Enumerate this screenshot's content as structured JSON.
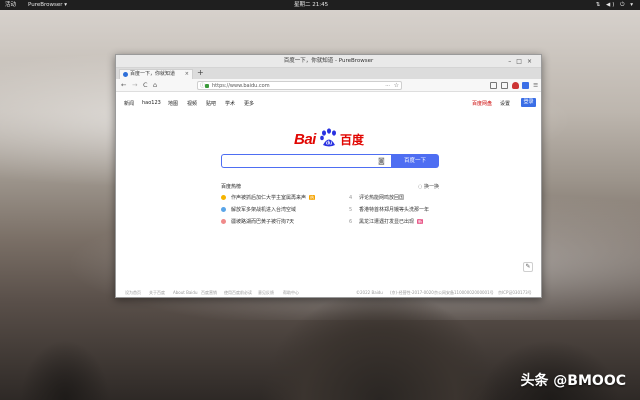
{
  "system_bar": {
    "activities": "活动",
    "app_menu": "PureBrowser ▾",
    "clock": "星期二 21:45",
    "tray": "⇅ ◀) ⏻ ▾"
  },
  "window": {
    "title": "百度一下，你就知道 - PureBrowser",
    "controls": [
      "–",
      "□",
      "×"
    ]
  },
  "tabs": [
    {
      "label": "百度一下，你就知道",
      "close": "×"
    }
  ],
  "new_tab": "+",
  "nav": {
    "back": "←",
    "forward": "→",
    "reload": "C",
    "home": "⌂",
    "url": "https://www.baidu.com",
    "url_info": "ⓘ",
    "page_menu": "···",
    "bookmark": "☆"
  },
  "baidu": {
    "top_links": [
      "新闻",
      "hao123",
      "地图",
      "视频",
      "贴吧",
      "学术",
      "更多"
    ],
    "login_link": "百度网盘",
    "settings": "设置",
    "login_button": "登录",
    "logo_text": "Bai",
    "logo_paw_text": "du",
    "logo_cn": "百度",
    "search_value": "",
    "camera_icon": "◙",
    "search_button": "百度一下",
    "hot_title": "百度热榜",
    "hot_refresh": "◌ 换一换",
    "hot_left": [
      {
        "text": "作声被抓后加仁大学主室属再来声",
        "badge": "热"
      },
      {
        "text": "解放军多架战机进入台湾空域",
        "badge": ""
      },
      {
        "text": "疆坡路湖而巴黄子被行拘7天",
        "badge": ""
      }
    ],
    "hot_right": [
      {
        "num": "4",
        "text": "评论热能网鸣放回国",
        "badge": ""
      },
      {
        "num": "5",
        "text": "香港特首林郑月娥等头洗那一年",
        "badge": ""
      },
      {
        "num": "6",
        "text": "黑龙江遭遇打发显已出现",
        "badge": "新"
      }
    ],
    "side_icon": "✎",
    "footer": [
      "设为首页",
      "关于百度",
      "About Baidu",
      "百度营销",
      "使用百度前必读",
      "意见反馈",
      "帮助中心",
      "©2022 Baidu",
      "(京)-经营性-2017-0020",
      "京公网安备11000002000001号",
      "京ICP证030173号"
    ]
  },
  "watermark": "头条 @BMOOC",
  "colors": {
    "baidu_red": "#e10602",
    "baidu_blue": "#4e6ef2",
    "hot_dot_1": "#f5b400",
    "hot_dot_2": "#5aa5e8",
    "hot_dot_3": "#f08a8a"
  }
}
